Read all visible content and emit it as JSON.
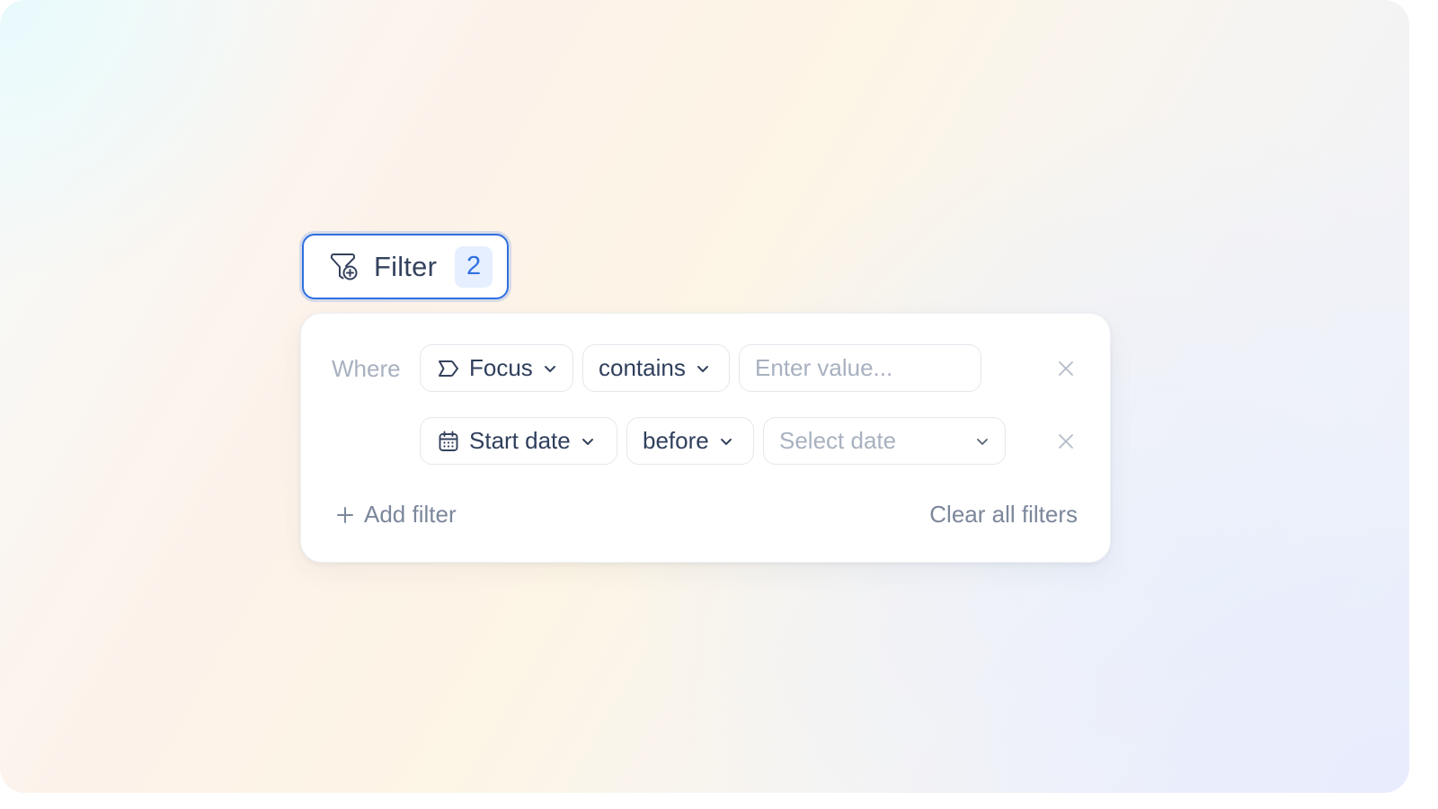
{
  "filter_button": {
    "label": "Filter",
    "count": "2",
    "icon": "filter-add-icon",
    "accent_color": "#2f6fe0"
  },
  "panel": {
    "where_label": "Where",
    "rows": [
      {
        "field": "Focus",
        "field_icon": "tag-icon",
        "operator": "contains",
        "value_placeholder": "Enter value...",
        "value": ""
      },
      {
        "field": "Start date",
        "field_icon": "calendar-icon",
        "operator": "before",
        "value_placeholder": "Select date",
        "value": ""
      }
    ],
    "add_filter_label": "Add filter",
    "clear_all_label": "Clear all filters"
  }
}
